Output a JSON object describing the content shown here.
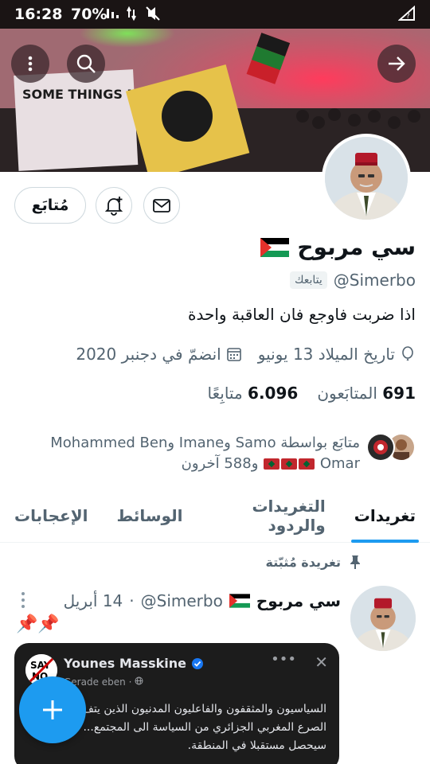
{
  "status_bar": {
    "time": "16:28",
    "battery": "70%"
  },
  "profile": {
    "name": "سي مربوح",
    "handle": "@Simerbo",
    "follows_you": "يتابعك",
    "bio": "اذا ضربت فاوجع فان العاقبة واحدة",
    "birthday": "تاريخ الميلاد 13 يونيو",
    "joined": "انضمّ في دجنبر 2020",
    "following_count": "691",
    "following_label": "المتابَعون",
    "followers_count": "6.096",
    "followers_label": "متابِعًا",
    "followed_by_line1": "متابَع بواسطة Samo وImane وMohammed Ben",
    "followed_by_omar": "Omar",
    "followed_by_others": "و588 آخرون",
    "follow_button": "مُتابَع"
  },
  "tabs": [
    {
      "label": "تغريدات",
      "active": true
    },
    {
      "label": "التغريدات والردود",
      "active": false
    },
    {
      "label": "الوسائط",
      "active": false
    },
    {
      "label": "الإعجابات",
      "active": false
    }
  ],
  "pinned_tweet": {
    "pinned_label": "تغريدة مُثبّتة",
    "author_name": "سي مربوح",
    "handle": "@Simerbo",
    "date": "14 أبريل",
    "separator": "·",
    "emoji": "📌📌",
    "quoted": {
      "author": "Younes Masskine",
      "subtitle": "Gerade eben ·",
      "text": "السياسيون والمثقفون والفاعليون المدنيون الذين يتف... تحول الصرع المغربي الجزائري من السياسة الى المجتمع... مسؤولية ما سيحصل مستقبلا في المنطقة."
    }
  },
  "colors": {
    "accent": "#1d9bf0",
    "text_primary": "#0f1419",
    "text_secondary": "#536471",
    "status_bar": "#1a1414"
  },
  "icons": {
    "menu": "more-vertical-icon",
    "search": "search-icon",
    "forward": "arrow-right-icon",
    "mail": "mail-icon",
    "notify": "bell-plus-icon",
    "fab": "plus-icon"
  }
}
